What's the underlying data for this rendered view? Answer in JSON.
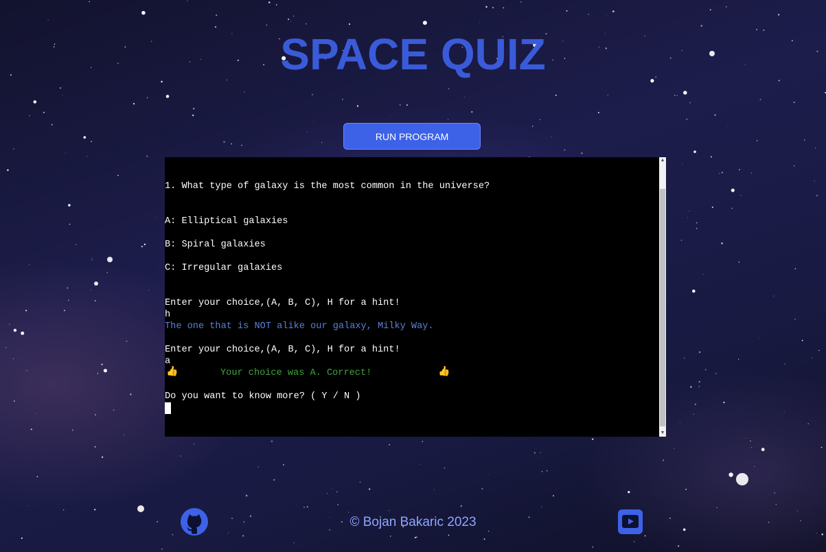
{
  "page": {
    "title": "SPACE QUIZ"
  },
  "toolbar": {
    "run_label": "RUN PROGRAM"
  },
  "terminal": {
    "lines": [
      "1. What type of galaxy is the most common in the universe?",
      "A: Elliptical galaxies",
      "B: Spiral galaxies",
      "C: Irregular galaxies",
      "Enter your choice,(A, B, C), H for a hint!",
      "h",
      "The one that is NOT alike our galaxy, Milky Way.",
      "Enter your choice,(A, B, C), H for a hint!",
      "a",
      "Your choice was A. Correct!",
      "Do you want to know more? ( Y / N )"
    ],
    "thumb_icon": "👍"
  },
  "footer": {
    "copyright": "© Bojan Bakaric 2023",
    "github_icon": "github-icon",
    "youtube_icon": "youtube-icon"
  },
  "colors": {
    "accent": "#3a5bd9",
    "button": "#3d62e8",
    "hint_text": "#5b80d6",
    "correct_text": "#3fa33f",
    "footer_text": "#8fa6ff"
  }
}
